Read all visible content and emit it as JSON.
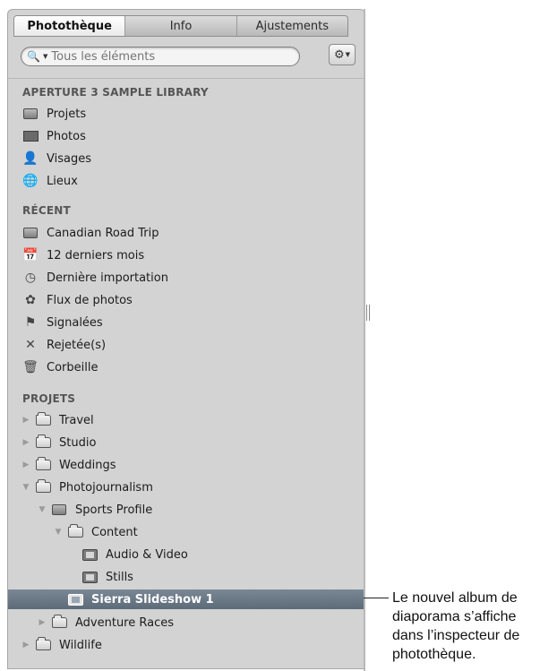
{
  "tabs": [
    {
      "label": "Photothèque",
      "active": true
    },
    {
      "label": "Info",
      "active": false
    },
    {
      "label": "Ajustements",
      "active": false
    }
  ],
  "search": {
    "placeholder": "Tous les éléments"
  },
  "gear": {
    "icon": "gear-icon"
  },
  "library": {
    "header": "APERTURE 3 SAMPLE LIBRARY",
    "items": [
      {
        "label": "Projets",
        "icon": "projects-icon"
      },
      {
        "label": "Photos",
        "icon": "photos-icon"
      },
      {
        "label": "Visages",
        "icon": "faces-icon"
      },
      {
        "label": "Lieux",
        "icon": "places-icon"
      }
    ]
  },
  "recent": {
    "header": "RÉCENT",
    "items": [
      {
        "label": "Canadian Road Trip",
        "icon": "project-box-icon"
      },
      {
        "label": "12 derniers mois",
        "icon": "calendar-icon"
      },
      {
        "label": "Dernière importation",
        "icon": "import-icon"
      },
      {
        "label": "Flux de photos",
        "icon": "photostream-icon"
      },
      {
        "label": "Signalées",
        "icon": "flag-icon"
      },
      {
        "label": "Rejetée(s)",
        "icon": "reject-x-icon"
      },
      {
        "label": "Corbeille",
        "icon": "trash-icon"
      }
    ]
  },
  "projects": {
    "header": "PROJETS",
    "items": [
      {
        "label": "Travel",
        "expanded": false
      },
      {
        "label": "Studio",
        "expanded": false
      },
      {
        "label": "Weddings",
        "expanded": false
      },
      {
        "label": "Photojournalism",
        "expanded": true
      },
      {
        "label": "Sports Profile",
        "expanded": true
      },
      {
        "label": "Content",
        "expanded": true
      },
      {
        "label": "Audio & Video"
      },
      {
        "label": "Stills"
      },
      {
        "label": "Sierra Slideshow 1",
        "selected": true
      },
      {
        "label": "Adventure Races",
        "expanded": false
      },
      {
        "label": "Wildlife",
        "expanded": false
      }
    ]
  },
  "callout": {
    "text": "Le nouvel album de diaporama s’affiche dans l’inspecteur de photothèque."
  }
}
